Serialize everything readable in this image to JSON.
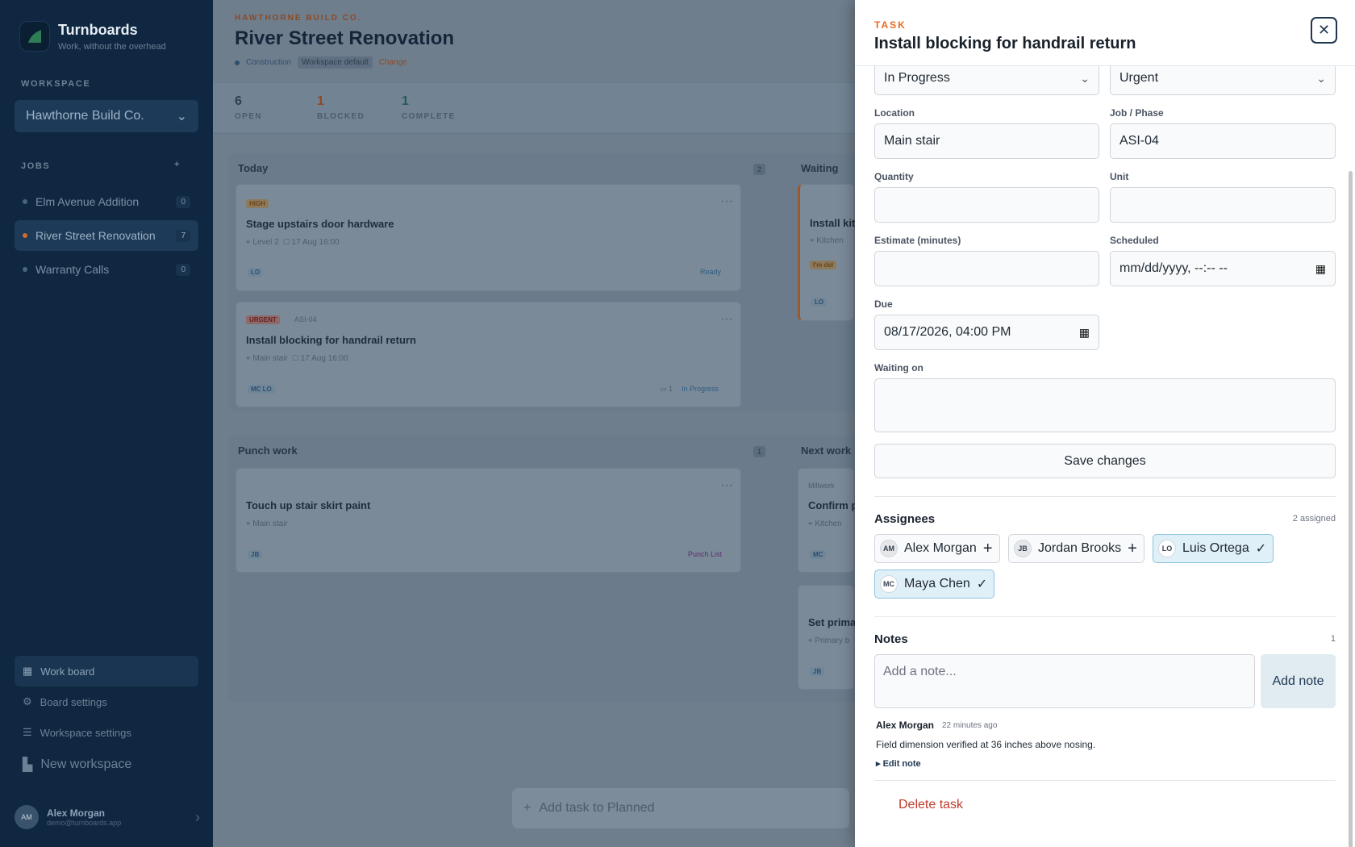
{
  "app": {
    "name": "Turnboards",
    "tagline": "Work, without the overhead"
  },
  "sidebar": {
    "workspace_label": "WORKSPACE",
    "workspace": "Hawthorne Build Co.",
    "jobs_label": "JOBS",
    "jobs": [
      {
        "name": "Elm Avenue Addition",
        "count": "0"
      },
      {
        "name": "River Street Renovation",
        "count": "7"
      },
      {
        "name": "Warranty Calls",
        "count": "0"
      }
    ],
    "nav": [
      "Work board",
      "Board settings",
      "Workspace settings",
      "New workspace"
    ],
    "user": {
      "name": "Alex Morgan",
      "email": "demo@turnboards.app",
      "initials": "AM"
    }
  },
  "page": {
    "crumb": "HAWTHORNE BUILD CO.",
    "title": "River Street Renovation",
    "meta": {
      "type": "Construction",
      "template": "Workspace default",
      "change": "Change"
    },
    "stats": [
      {
        "num": "6",
        "label": "OPEN",
        "color": "#2d3f52"
      },
      {
        "num": "1",
        "label": "BLOCKED",
        "color": "#8a4a26"
      },
      {
        "num": "1",
        "label": "COMPLETE",
        "color": "#2a5a54"
      }
    ]
  },
  "lanes": {
    "today": {
      "title": "Today",
      "count": "2"
    },
    "waiting": {
      "title": "Waiting"
    },
    "punch": {
      "title": "Punch work",
      "count": "1"
    },
    "next": {
      "title": "Next work"
    }
  },
  "cards": {
    "c1": {
      "tag": "HIGH",
      "title": "Stage upstairs door hardware",
      "loc": "Level 2",
      "date": "17 Aug 16:00",
      "user": "LO",
      "status": "Ready"
    },
    "c2": {
      "tag": "URGENT",
      "phase": "ASI-04",
      "title": "Install blocking for handrail return",
      "loc": "Main stair",
      "date": "17 Aug 16:00",
      "users": "MC LO",
      "comments": "1",
      "status": "In Progress"
    },
    "c3": {
      "title": "Touch up stair skirt paint",
      "loc": "Main stair",
      "user": "JB",
      "status": "Punch List"
    },
    "w1": {
      "title": "Install kit",
      "loc": "Kitchen",
      "flag": "I'm del",
      "user": "LO"
    },
    "n1": {
      "tag": "Millwork",
      "title": "Confirm p",
      "loc": "Kitchen",
      "user": "MC"
    },
    "n2": {
      "title": "Set prima",
      "loc": "Primary b",
      "user": "JB"
    }
  },
  "add_task": "Add task to Planned",
  "task": {
    "kicker": "TASK",
    "title": "Install blocking for handrail return",
    "status": "In Progress",
    "priority": "Urgent",
    "location_label": "Location",
    "location": "Main stair",
    "phase_label": "Job / Phase",
    "phase": "ASI-04",
    "quantity_label": "Quantity",
    "quantity": "",
    "unit_label": "Unit",
    "unit": "",
    "estimate_label": "Estimate (minutes)",
    "estimate": "",
    "scheduled_label": "Scheduled",
    "scheduled": "mm/dd/yyyy, --:-- --",
    "due_label": "Due",
    "due": "08/17/2026, 04:00 PM",
    "waiting_label": "Waiting on",
    "waiting": "",
    "save": "Save changes",
    "assignees_label": "Assignees",
    "assigned_count": "2 assigned",
    "assignees": [
      {
        "initials": "AM",
        "name": "Alex Morgan",
        "on": false
      },
      {
        "initials": "JB",
        "name": "Jordan Brooks",
        "on": false
      },
      {
        "initials": "LO",
        "name": "Luis Ortega",
        "on": true
      },
      {
        "initials": "MC",
        "name": "Maya Chen",
        "on": true
      }
    ],
    "notes_label": "Notes",
    "notes_count": "1",
    "note_placeholder": "Add a note...",
    "add_note": "Add note",
    "note": {
      "author": "Alex Morgan",
      "time": "22 minutes ago",
      "text": "Field dimension verified at 36 inches above nosing.",
      "edit": "Edit note"
    },
    "delete": "Delete task"
  }
}
